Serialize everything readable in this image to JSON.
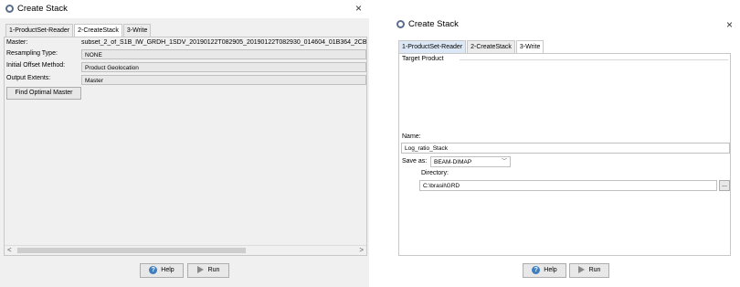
{
  "left": {
    "title": "Create Stack",
    "close": "×",
    "tabs": [
      "1-ProductSet-Reader",
      "2-CreateStack",
      "3-Write"
    ],
    "master_label": "Master:",
    "master_value": "subset_2_of_S1B_IW_GRDH_1SDV_20190122T082905_20190122T082930_014604_01B364_2CB1_C",
    "resampling_label": "Resampling Type:",
    "resampling_value": "NONE",
    "offset_label": "Initial Offset Method:",
    "offset_value": "Product Geolocation",
    "extents_label": "Output Extents:",
    "extents_value": "Master",
    "find_master": "Find Optimal Master",
    "scroll_left": "<",
    "scroll_right": ">",
    "help": "Help",
    "run": "Run"
  },
  "right": {
    "title": "Create Stack",
    "close": "×",
    "tabs": [
      "1-ProductSet-Reader",
      "2-CreateStack",
      "3-Write"
    ],
    "target_product": "Target Product",
    "name_label": "Name:",
    "name_value": "Log_ratio_Stack",
    "save_as_label": "Save as:",
    "save_as_value": "BEAM-DIMAP",
    "directory_label": "Directory:",
    "directory_value": "C:\\brasil\\GRD",
    "browse": "...",
    "help": "Help",
    "run": "Run"
  }
}
